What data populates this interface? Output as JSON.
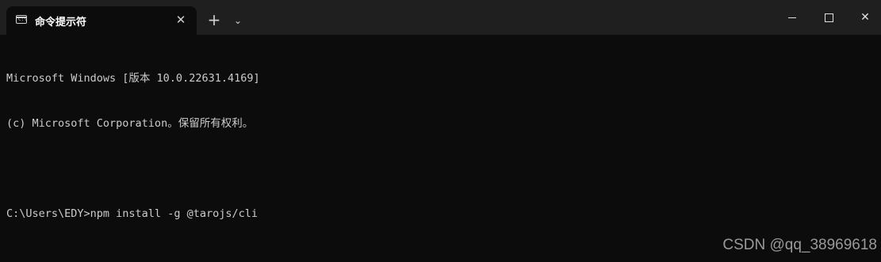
{
  "window": {
    "tab_title": "命令提示符",
    "tab_close_glyph": "✕",
    "new_tab_glyph": "+",
    "dropdown_glyph": "⌄",
    "close_glyph": "✕"
  },
  "terminal": {
    "lines": [
      "Microsoft Windows [版本 10.0.22631.4169]",
      "(c) Microsoft Corporation。保留所有权利。",
      "",
      "C:\\Users\\EDY>npm install -g @tarojs/cli"
    ]
  },
  "watermark": "CSDN @qq_38969618",
  "icons": {
    "tab": "command-prompt-icon",
    "new_tab": "plus-icon",
    "dropdown": "chevron-down-icon",
    "minimize": "minimize-icon",
    "maximize": "maximize-icon",
    "close": "close-icon"
  }
}
